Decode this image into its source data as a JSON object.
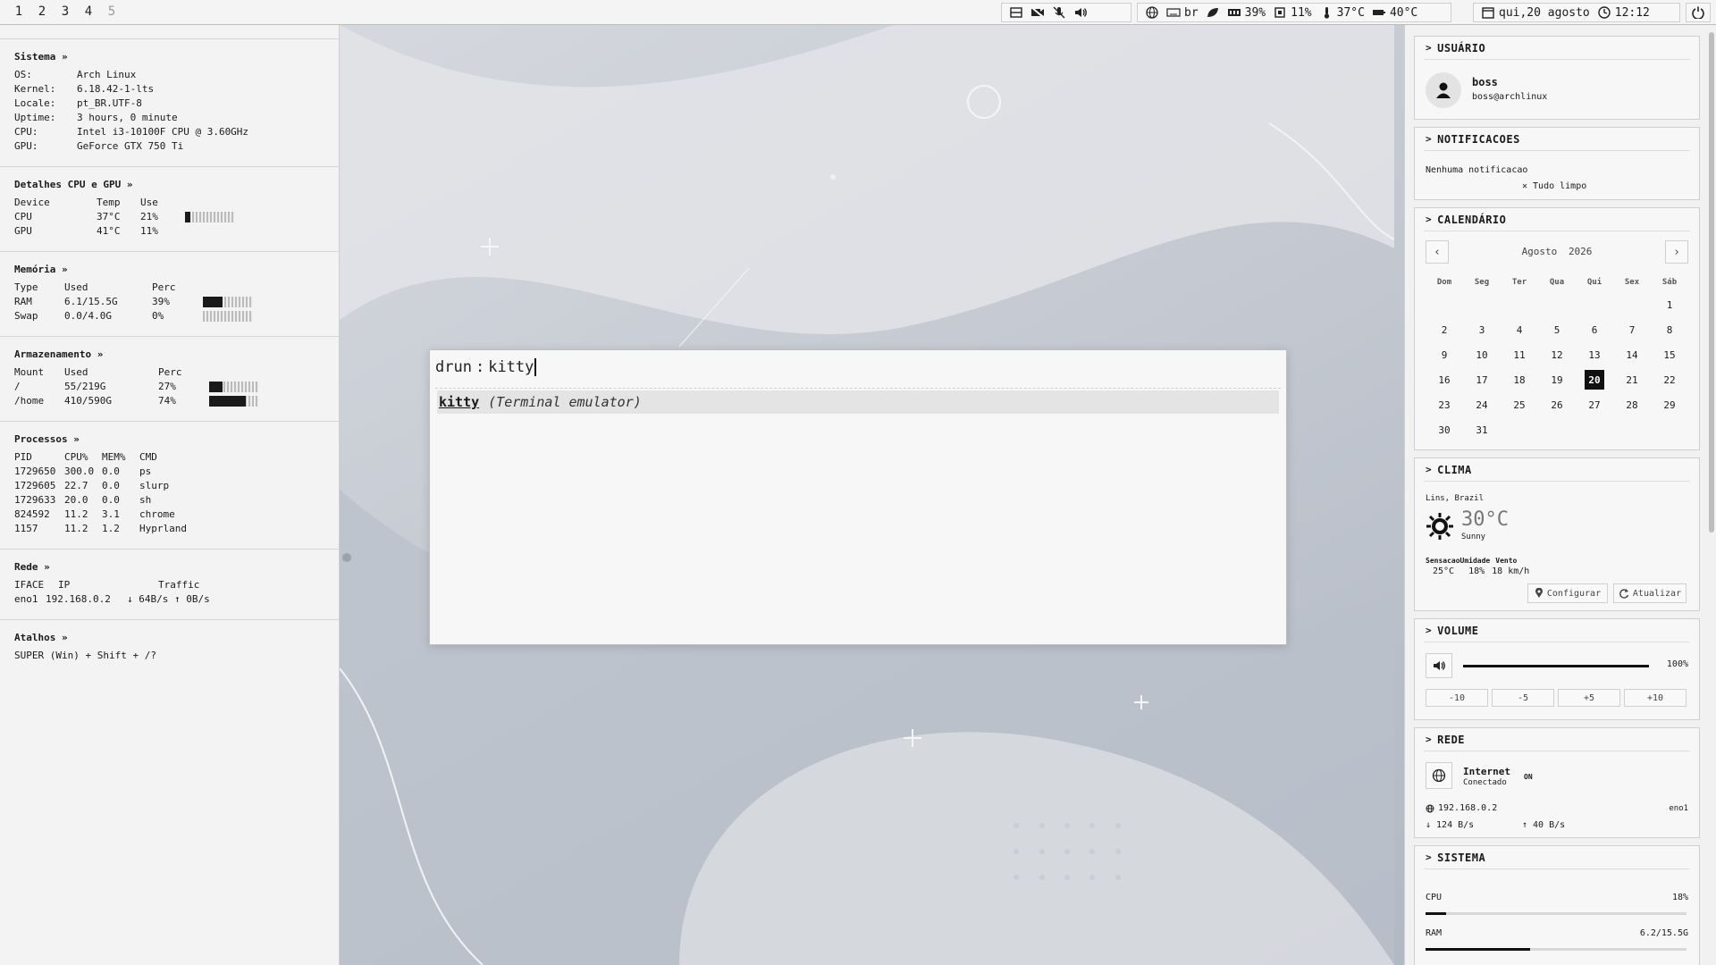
{
  "topbar": {
    "workspaces": [
      "1",
      "2",
      "3",
      "4",
      "5"
    ],
    "keyboard_layout": "br",
    "memory_pct": "39%",
    "cpu_pct": "11%",
    "temp": "37°C",
    "gpu_temp": "40°C",
    "date": "qui,20 agosto",
    "time": "12:12"
  },
  "left": {
    "sistema": {
      "title": "Sistema »",
      "rows": [
        {
          "k": "OS:",
          "v": "Arch Linux"
        },
        {
          "k": "Kernel:",
          "v": "6.18.42-1-lts"
        },
        {
          "k": "Locale:",
          "v": "pt_BR.UTF-8"
        },
        {
          "k": "Uptime:",
          "v": "3 hours, 0 minute"
        },
        {
          "k": "CPU:",
          "v": "Intel i3-10100F CPU @ 3.60GHz"
        },
        {
          "k": "GPU:",
          "v": "GeForce GTX 750 Ti"
        }
      ]
    },
    "cpugpu": {
      "title": "Detalhes CPU e GPU »",
      "headers": [
        "Device",
        "Temp",
        "Use"
      ],
      "rows": [
        {
          "device": "CPU",
          "temp": "37°C",
          "use": "21%",
          "fill": 0.1
        },
        {
          "device": "GPU",
          "temp": "41°C",
          "use": "11%"
        }
      ]
    },
    "memoria": {
      "title": "Memória »",
      "headers": [
        "Type",
        "Used",
        "Perc"
      ],
      "rows": [
        {
          "type": "RAM",
          "used": "6.1/15.5G",
          "perc": "39%",
          "fill": 0.39
        },
        {
          "type": "Swap",
          "used": "0.0/4.0G",
          "perc": "0%",
          "fill": 0
        }
      ]
    },
    "armazenamento": {
      "title": "Armazenamento »",
      "headers": [
        "Mount",
        "Used",
        "Perc"
      ],
      "rows": [
        {
          "mount": "/",
          "used": "55/219G",
          "perc": "27%",
          "fill": 0.27
        },
        {
          "mount": "/home",
          "used": "410/590G",
          "perc": "74%",
          "fill": 0.74
        }
      ]
    },
    "processos": {
      "title": "Processos »",
      "headers": [
        "PID",
        "CPU%",
        "MEM%",
        "CMD"
      ],
      "rows": [
        {
          "pid": "1729650",
          "cpu": "300.0",
          "mem": "0.0",
          "cmd": "ps"
        },
        {
          "pid": "1729605",
          "cpu": "22.7",
          "mem": "0.0",
          "cmd": "slurp"
        },
        {
          "pid": "1729633",
          "cpu": "20.0",
          "mem": "0.0",
          "cmd": "sh"
        },
        {
          "pid": "824592",
          "cpu": "11.2",
          "mem": "3.1",
          "cmd": "chrome"
        },
        {
          "pid": "1157",
          "cpu": "11.2",
          "mem": "1.2",
          "cmd": "Hyprland"
        }
      ]
    },
    "rede": {
      "title": "Rede »",
      "headers": [
        "IFACE",
        "IP",
        "Traffic"
      ],
      "row": {
        "iface": "eno1",
        "ip": "192.168.0.2",
        "traffic": "↓ 64B/s ↑ 0B/s"
      }
    },
    "atalhos": {
      "title": "Atalhos »",
      "text": "SUPER (Win) + Shift + /?"
    }
  },
  "launcher": {
    "prompt": "drun",
    "query": "kitty",
    "result_name": "kitty",
    "result_desc": "(Terminal emulator)"
  },
  "right": {
    "usuario": {
      "title": "USUÁRIO",
      "name": "boss",
      "host": "boss@archlinux"
    },
    "notificacoes": {
      "title": "NOTIFICACOES",
      "empty": "Nenhuma notificacao",
      "clear": "Tudo limpo"
    },
    "calendario": {
      "title": "CALENDÁRIO",
      "month": "Agosto",
      "year": "2026",
      "days": [
        "Dom",
        "Seg",
        "Ter",
        "Qua",
        "Qui",
        "Sex",
        "Sáb"
      ],
      "today": "20"
    },
    "clima": {
      "title": "CLIMA",
      "location": "Lins, Brazil",
      "temp": "30°C",
      "cond": "Sunny",
      "feels_label": "Sensacao",
      "feels": "25°C",
      "hum_label": "Umidade",
      "hum": "18%",
      "wind_label": "Vento",
      "wind": "18 km/h",
      "configure": "Configurar",
      "refresh": "Atualizar"
    },
    "volume": {
      "title": "VOLUME",
      "value": "100%",
      "level": 1.0,
      "steps": [
        "-10",
        "-5",
        "+5",
        "+10"
      ]
    },
    "rede": {
      "title": "REDE",
      "name": "Internet",
      "status": "Conectado",
      "state": "ON",
      "ip": "192.168.0.2",
      "iface": "eno1",
      "down": "↓ 124 B/s",
      "up": "↑ 40 B/s"
    },
    "sistema": {
      "title": "SISTEMA",
      "cpu_label": "CPU",
      "cpu_value": "18%",
      "cpu_level": 0.08,
      "ram_label": "RAM",
      "ram_value": "6.2/15.5G",
      "ram_level": 0.4
    }
  }
}
